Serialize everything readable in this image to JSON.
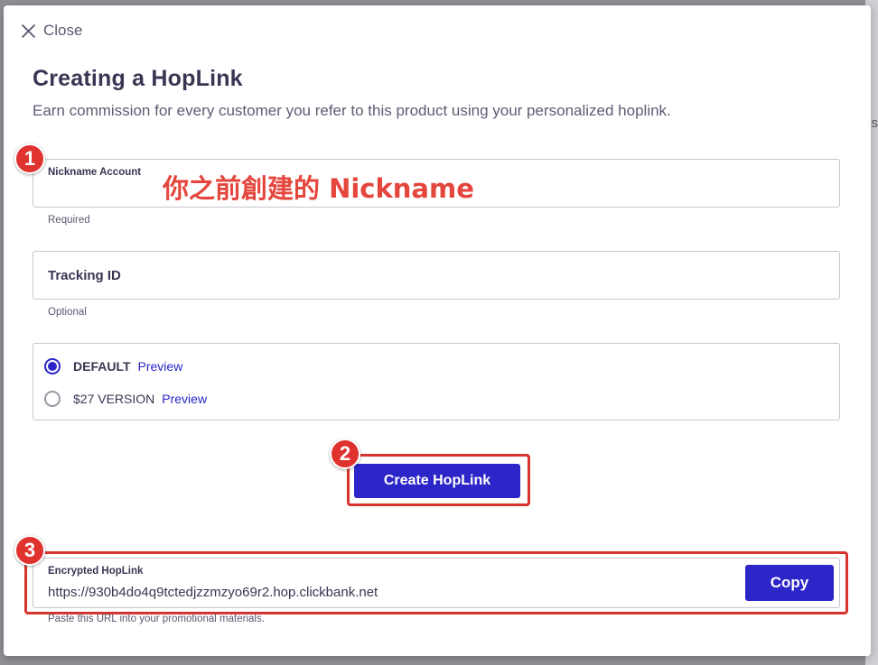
{
  "backdrop": {
    "edge_text": "es"
  },
  "modal": {
    "close_label": "Close",
    "title": "Creating a HopLink",
    "subtitle": "Earn commission for every customer you refer to this product using your personalized hoplink."
  },
  "nickname_field": {
    "label": "Nickname Account",
    "value": "",
    "helper": "Required",
    "annotation": "你之前創建的 Nickname"
  },
  "tracking_field": {
    "label": "Tracking ID",
    "value": "",
    "helper": "Optional"
  },
  "versions": {
    "options": [
      {
        "name": "DEFAULT",
        "preview": "Preview",
        "selected": true
      },
      {
        "name": "$27 VERSION",
        "preview": "Preview",
        "selected": false
      }
    ]
  },
  "create_button": {
    "label": "Create HopLink"
  },
  "encrypted": {
    "label": "Encrypted HopLink",
    "url": "https://930b4do4q9tctedjzzmzyo69r2.hop.clickbank.net",
    "copy_label": "Copy",
    "helper": "Paste this URL into your promotional materials."
  },
  "badges": [
    "1",
    "2",
    "3"
  ],
  "colors": {
    "accent": "#2c25c8",
    "annotation": "#e0322f"
  }
}
